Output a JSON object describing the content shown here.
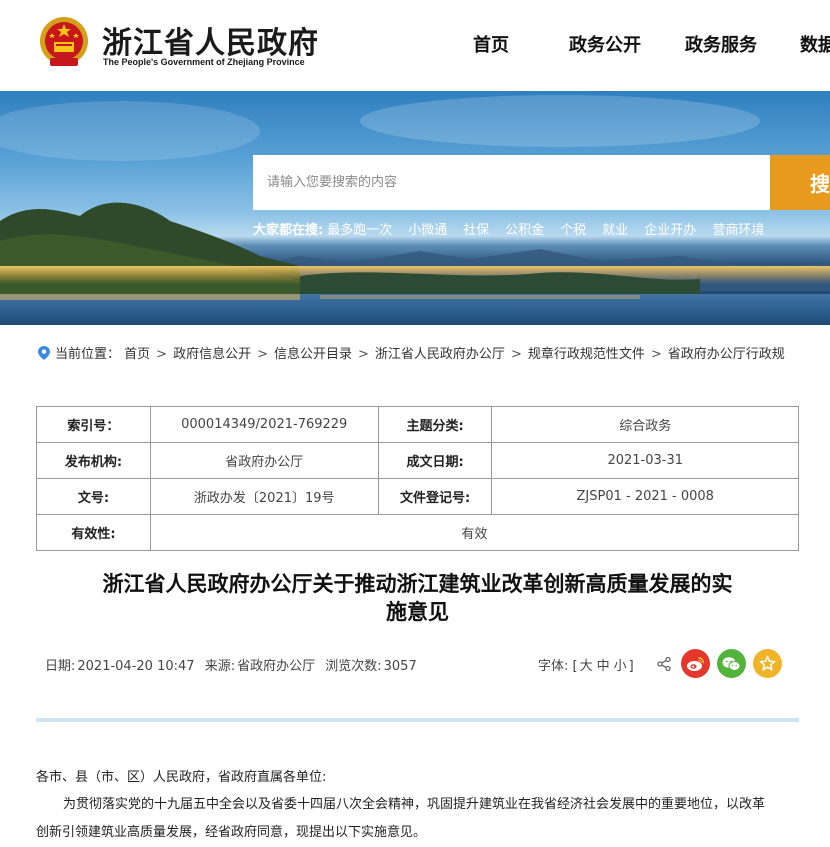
{
  "header": {
    "title": "浙江省人民政府",
    "subtitle": "The People's Government of Zhejiang Province",
    "nav": [
      {
        "label": "首页"
      },
      {
        "label": "政务公开"
      },
      {
        "label": "政务服务"
      },
      {
        "label": "数据"
      }
    ]
  },
  "search": {
    "placeholder": "请输入您要搜索的内容",
    "button_label": "搜",
    "hot_label": "大家都在搜:",
    "hot_items": [
      "最多跑一次",
      "小微通",
      "社保",
      "公积金",
      "个税",
      "就业",
      "企业开办",
      "营商环境"
    ]
  },
  "breadcrumb": {
    "prefix": "当前位置：",
    "items": [
      "首页",
      "政府信息公开",
      "信息公开目录",
      "浙江省人民政府办公厅",
      "规章行政规范性文件",
      "省政府办公厅行政规"
    ],
    "separator": ">"
  },
  "info": {
    "index_label": "索引号：",
    "index_value": "000014349/2021-769229",
    "category_label": "主题分类:",
    "category_value": "综合政务",
    "issuer_label": "发布机构:",
    "issuer_value": "省政府办公厅",
    "date_label": "成文日期:",
    "date_value": "2021-03-31",
    "docno_label": "文号:",
    "docno_value": "浙政办发〔2021〕19号",
    "regno_label": "文件登记号:",
    "regno_value": "ZJSP01 - 2021 - 0008",
    "validity_label": "有效性:",
    "validity_value": "有效"
  },
  "article": {
    "title_line1": "浙江省人民政府办公厅关于推动浙江建筑业改革创新高质量发展的实",
    "title_line2": "施意见",
    "date_label": "日期:",
    "date_value": "2021-04-20 10:47",
    "source_label": "来源:",
    "source_value": "省政府办公厅",
    "views_label": "浏览次数:",
    "views_value": "3057",
    "fontsize_label": "字体:",
    "fontsize_open": "[",
    "fontsize_large": "大",
    "fontsize_medium": "中",
    "fontsize_small": "小",
    "fontsize_close": "]",
    "para1": "各市、县（市、区）人民政府，省政府直属各单位:",
    "para2": "为贯彻落实党的十九届五中全会以及省委十四届八次全会精神，巩固提升建筑业在我省经济社会发展中的重要地位，以改革",
    "para3": "创新引领建筑业高质量发展，经省政府同意，现提出以下实施意见。"
  },
  "colors": {
    "search_button": "#e89a1f",
    "divider": "#cfe3f6",
    "weibo": "#e6372e",
    "wechat": "#52b43b",
    "favorite": "#f0b429"
  },
  "icons": {
    "emblem": "national-emblem-icon",
    "location": "location-pin-icon",
    "share": "share-icon",
    "weibo": "weibo-icon",
    "wechat": "wechat-icon",
    "favorite": "star-icon"
  }
}
